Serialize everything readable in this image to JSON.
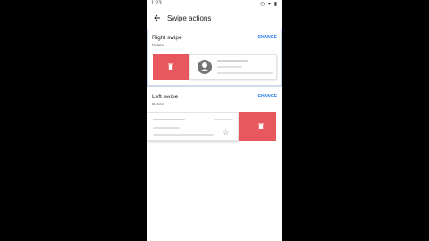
{
  "status": {
    "time": "1:23",
    "icons": "◷ ▾ ▮"
  },
  "appbar": {
    "title": "Swipe actions",
    "back_icon": "arrow-back-icon"
  },
  "right_swipe": {
    "title": "Right swipe",
    "action": "Delete",
    "change_label": "CHANGE"
  },
  "left_swipe": {
    "title": "Left swipe",
    "action": "Delete",
    "change_label": "CHANGE"
  },
  "colors": {
    "delete_red": "#e8575e",
    "accent": "#1a73e8"
  }
}
